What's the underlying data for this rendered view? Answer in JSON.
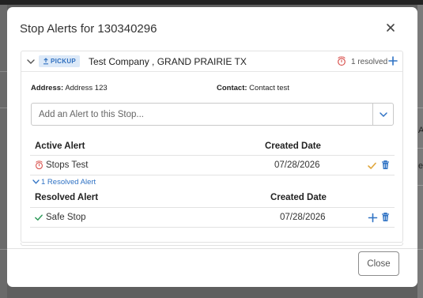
{
  "background": {
    "right_fragments": [
      "Ac",
      "e"
    ]
  },
  "modal": {
    "title": "Stop Alerts for 130340296",
    "close_button_label": "Close"
  },
  "stop": {
    "type_badge": "PICKUP",
    "company": "Test Company , GRAND PRAIRIE TX",
    "resolved_count": "1 resolved",
    "address_label": "Address:",
    "address_value": "Address 123",
    "contact_label": "Contact:",
    "contact_value": "Contact test"
  },
  "alert_select": {
    "placeholder": "Add an Alert to this Stop..."
  },
  "active_alerts": {
    "headers": [
      "Active Alert",
      "Created Date"
    ],
    "rows": [
      {
        "name": "Stops Test",
        "date": "07/28/2026"
      }
    ]
  },
  "resolved_toggle": "1 Resolved Alert",
  "resolved_alerts": {
    "headers": [
      "Resolved Alert",
      "Created Date"
    ],
    "rows": [
      {
        "name": "Safe Stop",
        "date": "07/28/2026"
      }
    ]
  },
  "colors": {
    "accent_blue": "#2f72c4",
    "alert_red": "#d9534f",
    "check_gold": "#e0a63a",
    "check_green": "#2e9b5a",
    "badge_bg": "#dce9f8"
  },
  "icons": [
    "close-icon",
    "chevron-down-icon",
    "upload-icon",
    "alarm-icon",
    "plus-icon",
    "check-icon",
    "trash-icon"
  ]
}
